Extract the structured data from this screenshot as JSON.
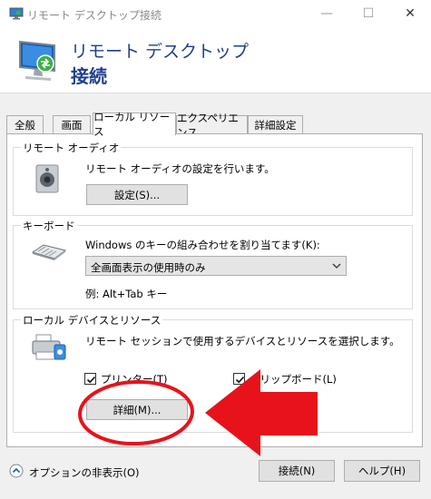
{
  "window": {
    "title": "リモート デスクトップ接続",
    "minimize": "—",
    "maximize": "☐",
    "close": "✕"
  },
  "header": {
    "line1": "リモート デスクトップ",
    "line2": "接続"
  },
  "tabs": [
    {
      "label": "全般",
      "active": false
    },
    {
      "label": "画面",
      "active": false
    },
    {
      "label": "ローカル リソース",
      "active": true
    },
    {
      "label": "エクスペリエンス",
      "active": false
    },
    {
      "label": "詳細設定",
      "active": false
    }
  ],
  "audio": {
    "group_label": "リモート オーディオ",
    "description": "リモート オーディオの設定を行います。",
    "settings_button": "設定(S)..."
  },
  "keyboard": {
    "group_label": "キーボード",
    "description": "Windows のキーの組み合わせを割り当てます(K):",
    "selected": "全画面表示の使用時のみ",
    "example": "例: Alt+Tab キー"
  },
  "local_devices": {
    "group_label": "ローカル デバイスとリソース",
    "description": "リモート セッションで使用するデバイスとリソースを選択します。",
    "printers_label": "プリンター(T)",
    "printers_checked": true,
    "clipboard_label": "クリップボード(L)",
    "clipboard_checked": true,
    "details_button": "詳細(M)..."
  },
  "footer": {
    "hide_options": "オプションの非表示(O)",
    "connect_button": "接続(N)",
    "help_button": "ヘルプ(H)"
  },
  "colors": {
    "accent_text": "#1f3f8f",
    "annotation_red": "#e8121b"
  }
}
